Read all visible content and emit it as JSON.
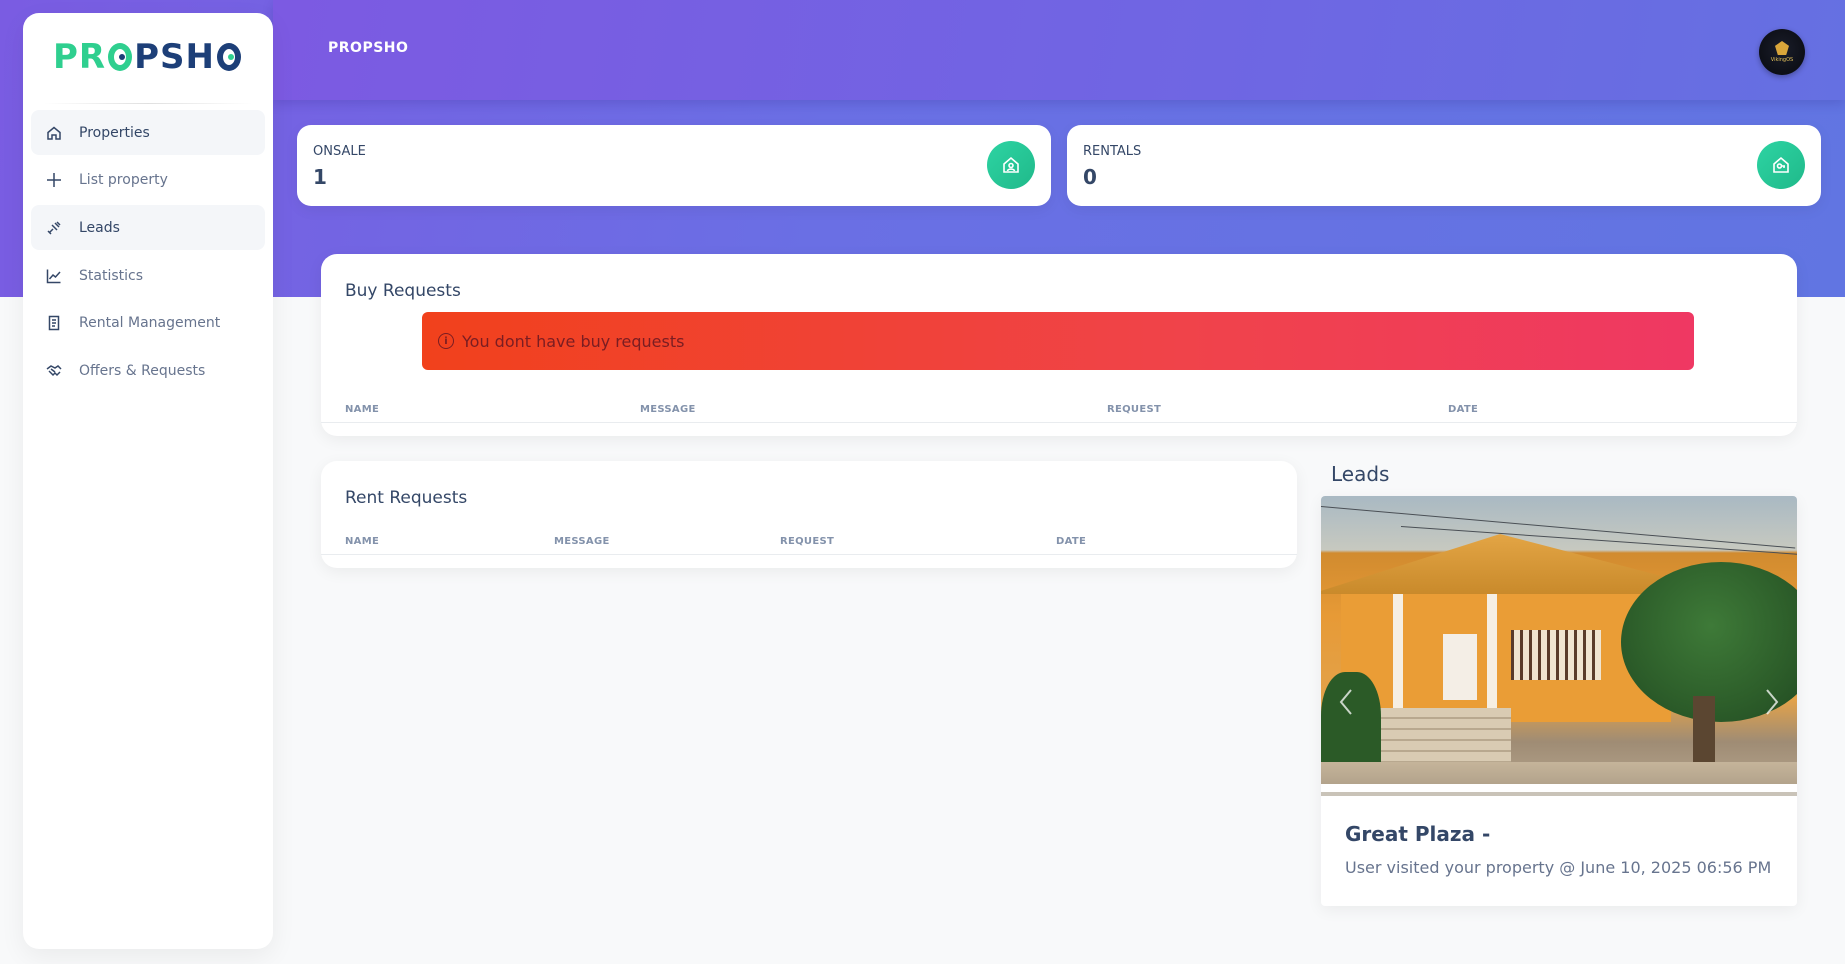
{
  "app": {
    "brand_top": "PROPSHO",
    "logo_text_left": "PR",
    "logo_text_mid": "PSH",
    "avatar_text": "VikingOS"
  },
  "sidebar": {
    "items": [
      {
        "label": "Properties",
        "icon": "home-icon",
        "active": true
      },
      {
        "label": "List property",
        "icon": "plus-icon",
        "active": false
      },
      {
        "label": "Leads",
        "icon": "satellite-icon",
        "active": true
      },
      {
        "label": "Statistics",
        "icon": "chart-line-icon",
        "active": false
      },
      {
        "label": "Rental Management",
        "icon": "document-icon",
        "active": false
      },
      {
        "label": "Offers & Requests",
        "icon": "handshake-icon",
        "active": false
      }
    ]
  },
  "stats": {
    "onsale": {
      "label": "ONSALE",
      "value": "1",
      "icon": "house-user-icon"
    },
    "rentals": {
      "label": "RENTALS",
      "value": "0",
      "icon": "house-key-icon"
    }
  },
  "buy_requests": {
    "title": "Buy Requests",
    "alert": "You dont have buy requests",
    "columns": [
      "NAME",
      "MESSAGE",
      "REQUEST",
      "DATE"
    ]
  },
  "rent_requests": {
    "title": "Rent Requests",
    "columns": [
      "NAME",
      "MESSAGE",
      "REQUEST",
      "DATE"
    ]
  },
  "leads": {
    "heading": "Leads",
    "card": {
      "title": "Great Plaza -",
      "description": "User visited your property @ June 10, 2025 06:56 PM"
    }
  },
  "colors": {
    "header_gradient_start": "#7a5ce2",
    "header_gradient_end": "#6175e2",
    "accent_green": "#2dd4a3",
    "alert_red": "#f0434a",
    "text_dark": "#344767"
  }
}
